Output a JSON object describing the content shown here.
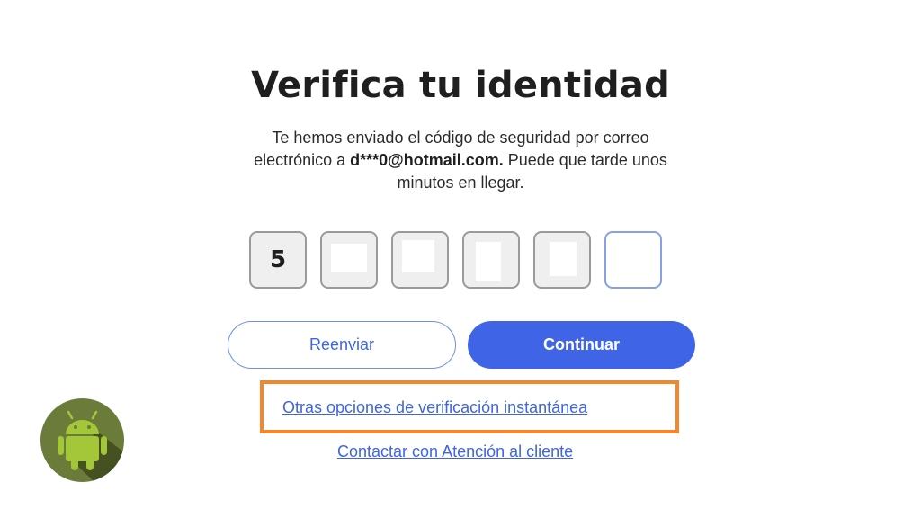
{
  "heading": "Verifica tu identidad",
  "subtitle": {
    "before": "Te hemos enviado el código de seguridad por correo electrónico a ",
    "email": "d***0@hotmail.com.",
    "after": " Puede que tarde unos minutos en llegar."
  },
  "code": {
    "digits": [
      "5",
      "",
      "",
      "",
      "",
      ""
    ],
    "active_index": 5
  },
  "buttons": {
    "resend_label": "Reenviar",
    "continue_label": "Continuar"
  },
  "links": {
    "other_options": "Otras opciones de verificación instantánea",
    "contact_support": "Contactar con Atención al cliente"
  },
  "colors": {
    "accent": "#3f64e6",
    "highlight": "#f5862a",
    "badge_bg": "#6b7b3a",
    "android_green": "#a4c639"
  },
  "icons": {
    "badge": "android-icon"
  }
}
